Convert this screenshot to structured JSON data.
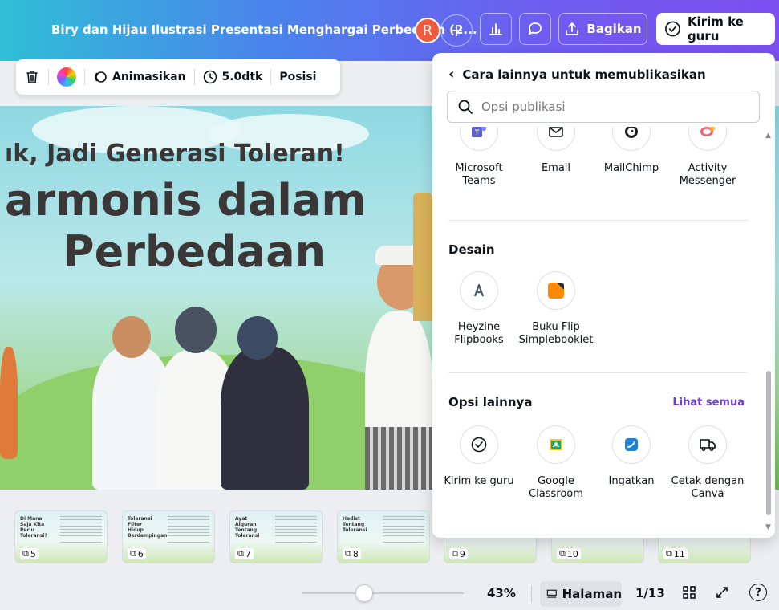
{
  "header": {
    "doc_title": "Biry dan Hijau Ilustrasi Presentasi Menghargai Perbedaan (2...",
    "avatar_initial": "R",
    "plus_icon": "plus-icon",
    "share_label": "Bagikan",
    "send_label": "Kirim ke guru",
    "colors": {
      "gradient_start": "#2fbfd6",
      "gradient_end": "#7d4ff0",
      "avatar": "#f05a3c"
    }
  },
  "element_toolbar": {
    "animate_label": "Animasikan",
    "duration_label": "5.0dtk",
    "position_label": "Posisi"
  },
  "slide": {
    "line1": "ık, Jadi Generasi Toleran!",
    "line2": "armonis dalam",
    "line3": "Perbedaan"
  },
  "thumbnails": [
    {
      "num": "5",
      "title": "Di Mana Saja Kita Perlu Toleransi?"
    },
    {
      "num": "6",
      "title": "Toleransi Filter Hidup Berdampingan"
    },
    {
      "num": "7",
      "title": "Ayat Alquran Tentang Toleransi"
    },
    {
      "num": "8",
      "title": "Hadist Tentang Toleransi"
    },
    {
      "num": "9",
      "title": ""
    },
    {
      "num": "10",
      "title": ""
    },
    {
      "num": "11",
      "title": ""
    }
  ],
  "bottombar": {
    "zoom": "43%",
    "zoom_fraction": 0.43,
    "pages_label": "Halaman",
    "page_count": "1/13",
    "help": "?"
  },
  "panel": {
    "back_title": "Cara lainnya untuk memublikasikan",
    "search_placeholder": "Opsi publikasi",
    "social": [
      {
        "label": "Microsoft Teams",
        "icon": "teams-icon"
      },
      {
        "label": "Email",
        "icon": "email-icon"
      },
      {
        "label": "MailChimp",
        "icon": "mailchimp-icon"
      },
      {
        "label": "Activity Messenger",
        "icon": "activity-messenger-icon"
      }
    ],
    "design_title": "Desain",
    "design": [
      {
        "label": "Heyzine Flipbooks",
        "icon": "heyzine-icon"
      },
      {
        "label": "Buku Flip Simplebooklet",
        "icon": "simplebooklet-icon"
      }
    ],
    "other_title": "Opsi lainnya",
    "see_all": "Lihat semua",
    "other": [
      {
        "label": "Kirim ke guru",
        "icon": "check-circle-icon"
      },
      {
        "label": "Google Classroom",
        "icon": "google-classroom-icon"
      },
      {
        "label": "Ingatkan",
        "icon": "reminder-icon"
      },
      {
        "label": "Cetak dengan Canva",
        "icon": "print-truck-icon"
      }
    ]
  }
}
